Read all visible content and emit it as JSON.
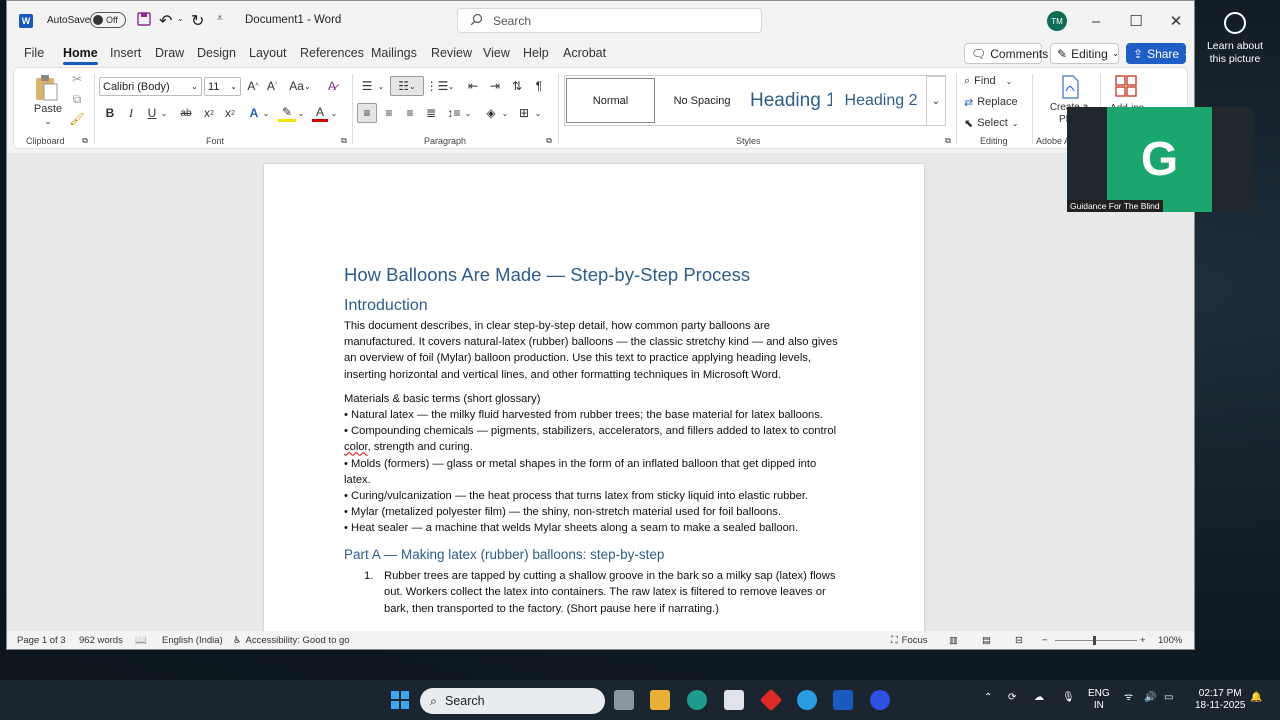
{
  "titlebar": {
    "autosave_label": "AutoSave",
    "autosave_state": "Off",
    "doc_title": "Document1 - Word",
    "search_placeholder": "Search",
    "avatar_initials": "TM"
  },
  "menu": {
    "tabs": [
      "File",
      "Home",
      "Insert",
      "Draw",
      "Design",
      "Layout",
      "References",
      "Mailings",
      "Review",
      "View",
      "Help",
      "Acrobat"
    ],
    "active": "Home",
    "comments": "Comments",
    "editing": "Editing",
    "share": "Share"
  },
  "ribbon": {
    "paste": "Paste",
    "clipboard": "Clipboard",
    "font_name": "Calibri (Body)",
    "font_size": "11",
    "font": "Font",
    "paragraph": "Paragraph",
    "styles_label": "Styles",
    "styles": [
      "Normal",
      "No Spacing",
      "Heading 1",
      "Heading 2"
    ],
    "find": "Find",
    "replace": "Replace",
    "select": "Select",
    "editing_label": "Editing",
    "create_pdf": "Create a PDF",
    "addins": "Add-ins",
    "adobe_label": "Adobe Ac"
  },
  "document": {
    "title": "How Balloons Are Made — Step-by-Step Process",
    "intro_heading": "Introduction",
    "intro": "This document describes, in clear step-by-step detail, how common party balloons are manufactured. It covers natural-latex (rubber) balloons — the classic stretchy kind — and also gives an overview of foil (Mylar) balloon production. Use this text to practice applying heading levels, inserting horizontal and vertical lines, and other formatting techniques in Microsoft Word.",
    "glossary_heading": "Materials & basic terms (short glossary)",
    "glossary": [
      "• Natural latex — the milky fluid harvested from rubber trees; the base material for latex balloons.",
      "• Compounding chemicals — pigments, stabilizers, accelerators, and fillers added to latex to control color, strength and curing.",
      "• Molds (formers) — glass or metal shapes in the form of an inflated balloon that get dipped into latex.",
      "• Curing/vulcanization — the heat process that turns latex from sticky liquid into elastic rubber.",
      "• Mylar (metalized polyester film) — the shiny, non-stretch material used for foil balloons.",
      "• Heat sealer — a machine that welds Mylar sheets along a seam to make a sealed balloon."
    ],
    "part_a_heading": "Part A — Making latex (rubber) balloons: step-by-step",
    "step1_num": "1.",
    "step1": "Rubber trees are tapped by cutting a shallow groove in the bark so a milky sap (latex) flows out. Workers collect the latex into containers. The raw latex is filtered to remove leaves or bark, then transported to the factory. (Short pause here if narrating.)"
  },
  "status": {
    "page": "Page 1 of 3",
    "words": "962 words",
    "language": "English (India)",
    "accessibility": "Accessibility: Good to go",
    "focus": "Focus",
    "zoom": "100%"
  },
  "overlay": {
    "initial": "G",
    "name": "Guidance For The Blind",
    "learn": "Learn about this picture"
  },
  "taskbar": {
    "search": "Search",
    "lang1": "ENG",
    "lang2": "IN",
    "time": "02:17 PM",
    "date": "18-11-2025"
  },
  "colors": {
    "accent": "#185abd",
    "heading": "#2e5d8a",
    "share": "#1f5fc5",
    "overlay_tile": "#1aa66c"
  }
}
